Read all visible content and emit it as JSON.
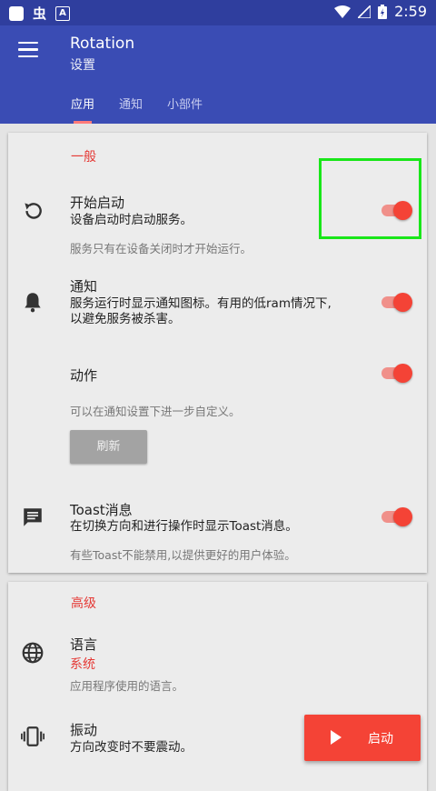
{
  "status_bar": {
    "time": "2:59",
    "icons": [
      "square-icon",
      "chinese-char-icon",
      "a-box-icon",
      "wifi-icon",
      "signal-icon",
      "battery-charging-icon"
    ]
  },
  "app_bar": {
    "title": "Rotation",
    "subtitle": "设置",
    "tabs": [
      {
        "label": "应用",
        "active": true
      },
      {
        "label": "通知",
        "active": false
      },
      {
        "label": "小部件",
        "active": false
      }
    ]
  },
  "general": {
    "header": "一般",
    "start": {
      "title": "开始启动",
      "text": "设备启动时启动服务。",
      "hint": "服务只有在设备关闭时才开始运行。",
      "enabled": true
    },
    "notification": {
      "title": "通知",
      "text1": "服务运行时显示通知图标。有用的低ram情况下,",
      "text2": "以避免服务被杀害。",
      "enabled": true
    },
    "action": {
      "title": "动作",
      "hint": "可以在通知设置下进一步自定义。",
      "refresh_label": "刷新",
      "enabled": true
    },
    "toast": {
      "title": "Toast消息",
      "text": "在切换方向和进行操作时显示Toast消息。",
      "hint": "有些Toast不能禁用,以提供更好的用户体验。",
      "enabled": true
    }
  },
  "advanced": {
    "header": "高级",
    "language": {
      "title": "语言",
      "value": "系统",
      "hint": "应用程序使用的语言。"
    },
    "vibration": {
      "title": "振动",
      "text": "方向改变时不要震动。"
    }
  },
  "fab": {
    "label": "启动"
  },
  "colors": {
    "primary": "#3a4cb4",
    "primary_dark": "#2f3e9e",
    "accent": "#f44336",
    "highlight": "#19e619"
  }
}
